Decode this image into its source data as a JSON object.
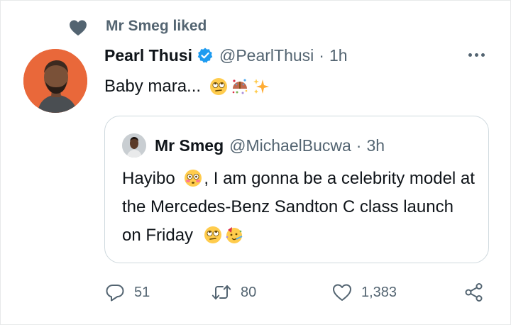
{
  "social_context": {
    "text": "Mr Smeg liked",
    "icon": "heart-icon"
  },
  "tweet": {
    "author_name": "Pearl Thusi",
    "verified": true,
    "handle": "@PearlThusi",
    "separator": "·",
    "time": "1h",
    "text": "Baby mara...",
    "emojis": [
      "rolling-eyes-emoji",
      "confetti-ball-emoji",
      "sparkles-emoji"
    ]
  },
  "quoted_tweet": {
    "author_name": "Mr Smeg",
    "handle": "@MichaelBucwa",
    "separator": "·",
    "time": "3h",
    "text_part1": "Hayibo",
    "text_part2": ", I am gonna be a celebrity model at the Mercedes-Benz Sandton C class launch on Friday",
    "emojis": [
      "flushed-face-emoji",
      "rolling-eyes-emoji",
      "partying-face-emoji"
    ]
  },
  "actions": {
    "reply_count": "51",
    "retweet_count": "80",
    "like_count": "1,383"
  },
  "colors": {
    "secondary_text": "#536471",
    "verified_blue": "#1d9bf0",
    "border": "#cfd9de",
    "avatar_bg": "#e9683a"
  }
}
